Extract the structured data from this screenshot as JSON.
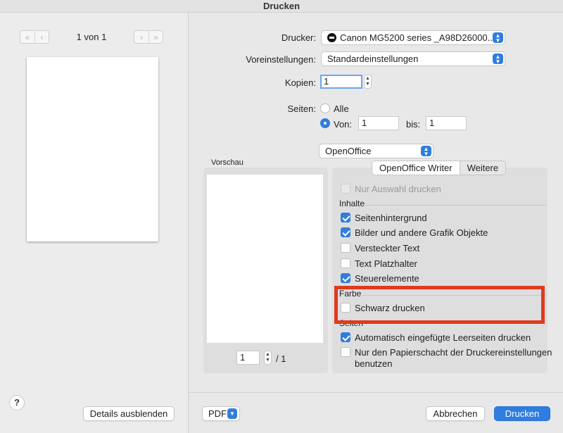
{
  "window": {
    "title": "Drucken"
  },
  "left": {
    "page_count": "1 von 1",
    "nav": {
      "first": "«",
      "prev": "‹",
      "next": "›",
      "last": "»"
    },
    "help": "?",
    "details_button": "Details ausblenden"
  },
  "form": {
    "printer_label": "Drucker:",
    "printer_value": "Canon MG5200 series _A98D26000...",
    "presets_label": "Voreinstellungen:",
    "presets_value": "Standardeinstellungen",
    "copies_label": "Kopien:",
    "copies_value": "1",
    "pages_label": "Seiten:",
    "pages_all": "Alle",
    "pages_from": "Von:",
    "pages_from_value": "1",
    "pages_to": "bis:",
    "pages_to_value": "1",
    "app_value": "OpenOffice"
  },
  "preview": {
    "label": "Vorschau",
    "page_value": "1",
    "page_total": "/ 1"
  },
  "tabs": [
    {
      "label": "OpenOffice Writer",
      "selected": true
    },
    {
      "label": "Weitere",
      "selected": false
    }
  ],
  "options": {
    "only_selection": {
      "label": "Nur Auswahl drucken",
      "checked": false,
      "disabled": true
    },
    "contents_title": "Inhalte",
    "contents": [
      {
        "label": "Seitenhintergrund",
        "checked": true
      },
      {
        "label": "Bilder und andere Grafik Objekte",
        "checked": true
      },
      {
        "label": "Versteckter Text",
        "checked": false
      },
      {
        "label": "Text Platzhalter",
        "checked": false
      },
      {
        "label": "Steuerelemente",
        "checked": true
      }
    ],
    "color_title": "Farbe",
    "color": [
      {
        "label": "Schwarz drucken",
        "checked": false
      }
    ],
    "pages_title": "Seiten",
    "pages": [
      {
        "label": "Automatisch eingefügte Leerseiten drucken",
        "checked": true
      },
      {
        "label": "Nur den Papierschacht der Druckereinstellungen",
        "label2": "benutzen",
        "checked": false
      }
    ]
  },
  "footer": {
    "pdf": "PDF",
    "cancel": "Abbrechen",
    "print": "Drucken"
  },
  "colors": {
    "accent": "#2f7de1",
    "highlight": "#e03a1e"
  }
}
